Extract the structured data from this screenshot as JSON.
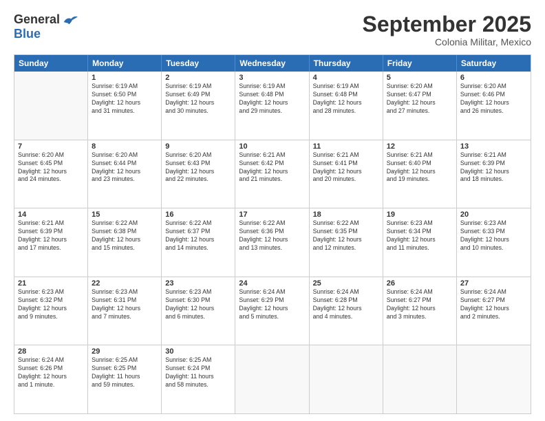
{
  "logo": {
    "general": "General",
    "blue": "Blue"
  },
  "title": "September 2025",
  "subtitle": "Colonia Militar, Mexico",
  "days": [
    "Sunday",
    "Monday",
    "Tuesday",
    "Wednesday",
    "Thursday",
    "Friday",
    "Saturday"
  ],
  "weeks": [
    [
      {
        "num": "",
        "info": ""
      },
      {
        "num": "1",
        "info": "Sunrise: 6:19 AM\nSunset: 6:50 PM\nDaylight: 12 hours\nand 31 minutes."
      },
      {
        "num": "2",
        "info": "Sunrise: 6:19 AM\nSunset: 6:49 PM\nDaylight: 12 hours\nand 30 minutes."
      },
      {
        "num": "3",
        "info": "Sunrise: 6:19 AM\nSunset: 6:48 PM\nDaylight: 12 hours\nand 29 minutes."
      },
      {
        "num": "4",
        "info": "Sunrise: 6:19 AM\nSunset: 6:48 PM\nDaylight: 12 hours\nand 28 minutes."
      },
      {
        "num": "5",
        "info": "Sunrise: 6:20 AM\nSunset: 6:47 PM\nDaylight: 12 hours\nand 27 minutes."
      },
      {
        "num": "6",
        "info": "Sunrise: 6:20 AM\nSunset: 6:46 PM\nDaylight: 12 hours\nand 26 minutes."
      }
    ],
    [
      {
        "num": "7",
        "info": "Sunrise: 6:20 AM\nSunset: 6:45 PM\nDaylight: 12 hours\nand 24 minutes."
      },
      {
        "num": "8",
        "info": "Sunrise: 6:20 AM\nSunset: 6:44 PM\nDaylight: 12 hours\nand 23 minutes."
      },
      {
        "num": "9",
        "info": "Sunrise: 6:20 AM\nSunset: 6:43 PM\nDaylight: 12 hours\nand 22 minutes."
      },
      {
        "num": "10",
        "info": "Sunrise: 6:21 AM\nSunset: 6:42 PM\nDaylight: 12 hours\nand 21 minutes."
      },
      {
        "num": "11",
        "info": "Sunrise: 6:21 AM\nSunset: 6:41 PM\nDaylight: 12 hours\nand 20 minutes."
      },
      {
        "num": "12",
        "info": "Sunrise: 6:21 AM\nSunset: 6:40 PM\nDaylight: 12 hours\nand 19 minutes."
      },
      {
        "num": "13",
        "info": "Sunrise: 6:21 AM\nSunset: 6:39 PM\nDaylight: 12 hours\nand 18 minutes."
      }
    ],
    [
      {
        "num": "14",
        "info": "Sunrise: 6:21 AM\nSunset: 6:39 PM\nDaylight: 12 hours\nand 17 minutes."
      },
      {
        "num": "15",
        "info": "Sunrise: 6:22 AM\nSunset: 6:38 PM\nDaylight: 12 hours\nand 15 minutes."
      },
      {
        "num": "16",
        "info": "Sunrise: 6:22 AM\nSunset: 6:37 PM\nDaylight: 12 hours\nand 14 minutes."
      },
      {
        "num": "17",
        "info": "Sunrise: 6:22 AM\nSunset: 6:36 PM\nDaylight: 12 hours\nand 13 minutes."
      },
      {
        "num": "18",
        "info": "Sunrise: 6:22 AM\nSunset: 6:35 PM\nDaylight: 12 hours\nand 12 minutes."
      },
      {
        "num": "19",
        "info": "Sunrise: 6:23 AM\nSunset: 6:34 PM\nDaylight: 12 hours\nand 11 minutes."
      },
      {
        "num": "20",
        "info": "Sunrise: 6:23 AM\nSunset: 6:33 PM\nDaylight: 12 hours\nand 10 minutes."
      }
    ],
    [
      {
        "num": "21",
        "info": "Sunrise: 6:23 AM\nSunset: 6:32 PM\nDaylight: 12 hours\nand 9 minutes."
      },
      {
        "num": "22",
        "info": "Sunrise: 6:23 AM\nSunset: 6:31 PM\nDaylight: 12 hours\nand 7 minutes."
      },
      {
        "num": "23",
        "info": "Sunrise: 6:23 AM\nSunset: 6:30 PM\nDaylight: 12 hours\nand 6 minutes."
      },
      {
        "num": "24",
        "info": "Sunrise: 6:24 AM\nSunset: 6:29 PM\nDaylight: 12 hours\nand 5 minutes."
      },
      {
        "num": "25",
        "info": "Sunrise: 6:24 AM\nSunset: 6:28 PM\nDaylight: 12 hours\nand 4 minutes."
      },
      {
        "num": "26",
        "info": "Sunrise: 6:24 AM\nSunset: 6:27 PM\nDaylight: 12 hours\nand 3 minutes."
      },
      {
        "num": "27",
        "info": "Sunrise: 6:24 AM\nSunset: 6:27 PM\nDaylight: 12 hours\nand 2 minutes."
      }
    ],
    [
      {
        "num": "28",
        "info": "Sunrise: 6:24 AM\nSunset: 6:26 PM\nDaylight: 12 hours\nand 1 minute."
      },
      {
        "num": "29",
        "info": "Sunrise: 6:25 AM\nSunset: 6:25 PM\nDaylight: 11 hours\nand 59 minutes."
      },
      {
        "num": "30",
        "info": "Sunrise: 6:25 AM\nSunset: 6:24 PM\nDaylight: 11 hours\nand 58 minutes."
      },
      {
        "num": "",
        "info": ""
      },
      {
        "num": "",
        "info": ""
      },
      {
        "num": "",
        "info": ""
      },
      {
        "num": "",
        "info": ""
      }
    ]
  ]
}
